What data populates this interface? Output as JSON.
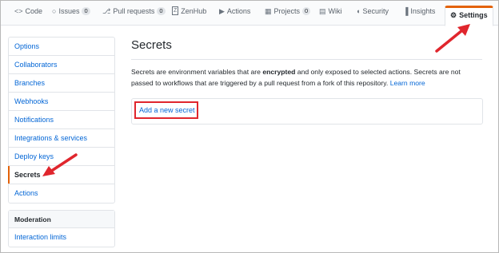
{
  "tabs": [
    {
      "icon": "code-icon",
      "glyph": "<>",
      "label": "Code"
    },
    {
      "icon": "issues-icon",
      "glyph": "○",
      "label": "Issues",
      "count": "0"
    },
    {
      "icon": "pull-request-icon",
      "glyph": "⎇",
      "label": "Pull requests",
      "count": "0"
    },
    {
      "icon": "zenhub-icon",
      "glyph": "Z",
      "label": "ZenHub"
    },
    {
      "icon": "actions-icon",
      "glyph": "▶",
      "label": "Actions"
    },
    {
      "icon": "projects-icon",
      "glyph": "▦",
      "label": "Projects",
      "count": "0"
    },
    {
      "icon": "wiki-icon",
      "glyph": "▤",
      "label": "Wiki"
    },
    {
      "icon": "security-icon",
      "glyph": "◖",
      "label": "Security"
    },
    {
      "icon": "insights-icon",
      "glyph": "▐",
      "label": "Insights"
    },
    {
      "icon": "gear-icon",
      "glyph": "⚙",
      "label": "Settings",
      "active": true
    }
  ],
  "sidebar": {
    "items": [
      {
        "label": "Options"
      },
      {
        "label": "Collaborators"
      },
      {
        "label": "Branches"
      },
      {
        "label": "Webhooks"
      },
      {
        "label": "Notifications"
      },
      {
        "label": "Integrations & services"
      },
      {
        "label": "Deploy keys"
      },
      {
        "label": "Secrets",
        "selected": true
      },
      {
        "label": "Actions"
      }
    ],
    "moderation": {
      "heading": "Moderation",
      "items": [
        {
          "label": "Interaction limits"
        }
      ]
    }
  },
  "main": {
    "title": "Secrets",
    "desc_part1": "Secrets are environment variables that are ",
    "desc_bold": "encrypted",
    "desc_part2": " and only exposed to selected actions. Secrets are not passed to workflows that are triggered by a pull request from a fork of this repository. ",
    "learn_more": "Learn more",
    "add_secret": "Add a new secret"
  },
  "colors": {
    "accent": "#e36209",
    "link": "#0366d6",
    "annotation": "#e0262d"
  }
}
